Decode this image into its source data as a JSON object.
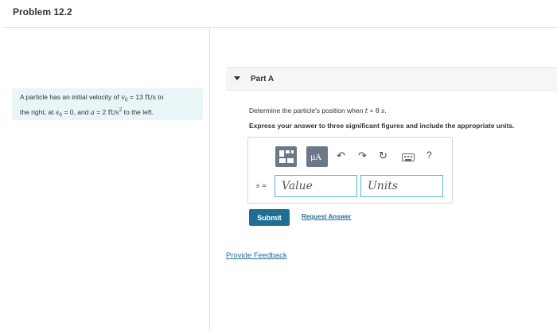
{
  "header": {
    "title": "Problem 12.2"
  },
  "problem": {
    "t1": "A particle has an initial velocity of ",
    "v0": "v",
    "v0_sub": "0",
    "eq1": " = 13 ",
    "ftps": "ft/s",
    "t2": " to",
    "t3": "the right, at ",
    "s0": "s",
    "s0_sub": "0",
    "eq2": " = 0, and ",
    "a": "a",
    "eq3": " = 2 ",
    "ftps2": "ft/s",
    "sq": "2",
    "t4": " to the left."
  },
  "part": {
    "title": "Part A"
  },
  "question": {
    "prefix": "Determine the particle's position when ",
    "t": "t",
    "eq": " = 8 ",
    "unit": "s",
    "end": "."
  },
  "instruction": "Express your answer to three significant figures and include the appropriate units.",
  "toolbar": {
    "units_glyph": "μA",
    "undo": "↶",
    "redo": "↷",
    "reset": "↻",
    "help": "?"
  },
  "answer": {
    "var": "s",
    "eq": " =",
    "value_placeholder": "Value",
    "units_placeholder": "Units"
  },
  "actions": {
    "submit": "Submit",
    "request_answer": "Request Answer"
  },
  "feedback": "Provide Feedback"
}
